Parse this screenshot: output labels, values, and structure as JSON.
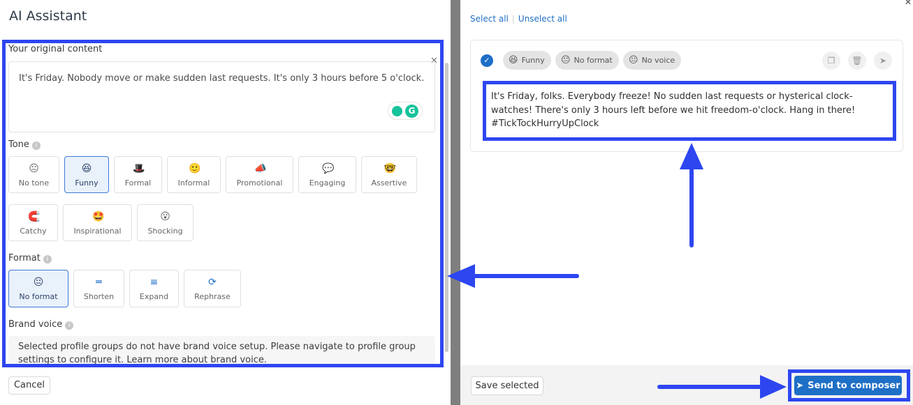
{
  "dialog": {
    "title": "AI Assistant",
    "original": {
      "label": "Your original content",
      "text": "It's Friday. Nobody move or make sudden last requests. It's only 3 hours before 5 o'clock."
    },
    "tone": {
      "label": "Tone",
      "options": [
        {
          "label": "No tone",
          "icon": "neutral-face-icon",
          "glyph": "😐"
        },
        {
          "label": "Funny",
          "icon": "laughing-face-icon",
          "glyph": "😆",
          "selected": true
        },
        {
          "label": "Formal",
          "icon": "top-hat-icon",
          "glyph": "🎩"
        },
        {
          "label": "Informal",
          "icon": "smiley-face-icon",
          "glyph": "🙂"
        },
        {
          "label": "Promotional",
          "icon": "megaphone-icon",
          "glyph": "📣"
        },
        {
          "label": "Engaging",
          "icon": "speech-bubble-icon",
          "glyph": "💬"
        },
        {
          "label": "Assertive",
          "icon": "nerd-face-icon",
          "glyph": "🤓"
        },
        {
          "label": "Catchy",
          "icon": "magnet-icon",
          "glyph": "🧲"
        },
        {
          "label": "Inspirational",
          "icon": "star-eyes-icon",
          "glyph": "🤩"
        },
        {
          "label": "Shocking",
          "icon": "surprised-face-icon",
          "glyph": "😮"
        }
      ]
    },
    "format": {
      "label": "Format",
      "options": [
        {
          "label": "No format",
          "icon": "neutral-face-icon",
          "glyph": "😐",
          "selected": true
        },
        {
          "label": "Shorten",
          "icon": "short-lines-icon",
          "glyph": "═"
        },
        {
          "label": "Expand",
          "icon": "long-lines-icon",
          "glyph": "≡"
        },
        {
          "label": "Rephrase",
          "icon": "refresh-icon",
          "glyph": "⟳"
        }
      ]
    },
    "brand_voice": {
      "label": "Brand voice",
      "message": "Selected profile groups do not have brand voice setup. Please navigate to profile group settings to configure it. Learn more about brand voice."
    },
    "cancel_label": "Cancel"
  },
  "results": {
    "select_all": "Select all",
    "unselect_all": "Unselect all",
    "tags": [
      {
        "label": "Funny",
        "glyph": "😆"
      },
      {
        "label": "No format",
        "glyph": "😐"
      },
      {
        "label": "No voice",
        "glyph": "😐"
      }
    ],
    "text": "It's Friday, folks. Everybody freeze! No sudden last requests or hysterical clock-watches! There's only 3 hours left before we hit freedom-o'clock. Hang in there! #TickTockHurryUpClock",
    "save_selected_label": "Save selected",
    "send_label": "Send to composer"
  },
  "colors": {
    "annotation": "#2d46f0",
    "accent": "#1e6fc6"
  }
}
